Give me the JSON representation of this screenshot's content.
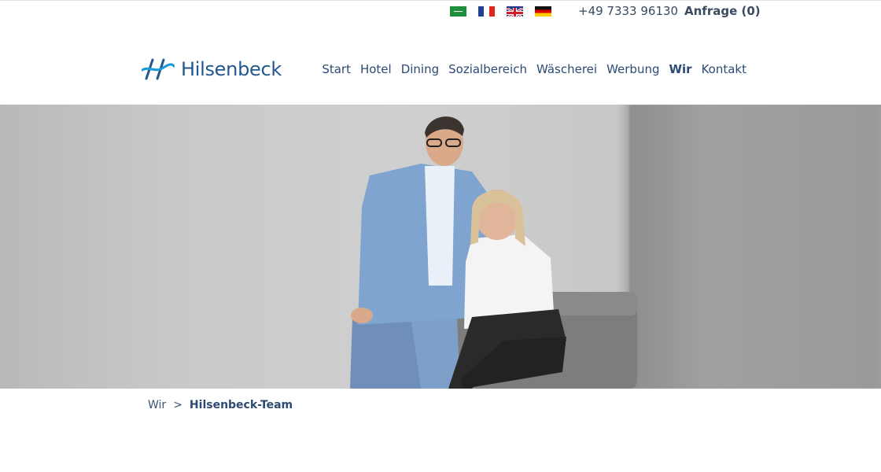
{
  "topbar": {
    "languages": [
      {
        "code": "ar",
        "name": "arabic-flag-icon"
      },
      {
        "code": "fr",
        "name": "france-flag-icon"
      },
      {
        "code": "en",
        "name": "uk-flag-icon"
      },
      {
        "code": "de",
        "name": "germany-flag-icon"
      }
    ],
    "phone": "+49 7333 96130",
    "inquiry_label": "Anfrage (0)"
  },
  "header": {
    "logo_text": "Hilsenbeck",
    "nav": [
      {
        "label": "Start"
      },
      {
        "label": "Hotel"
      },
      {
        "label": "Dining"
      },
      {
        "label": "Sozialbereich"
      },
      {
        "label": "Wäscherei"
      },
      {
        "label": "Werbung"
      },
      {
        "label": "Wir",
        "active": true
      },
      {
        "label": "Kontakt"
      }
    ]
  },
  "breadcrumb": {
    "parent": "Wir",
    "separator": ">",
    "current": "Hilsenbeck-Team"
  },
  "colors": {
    "brand": "#23588f",
    "nav_text": "#2c4a73",
    "accent_logo": "#1a9bd7"
  }
}
